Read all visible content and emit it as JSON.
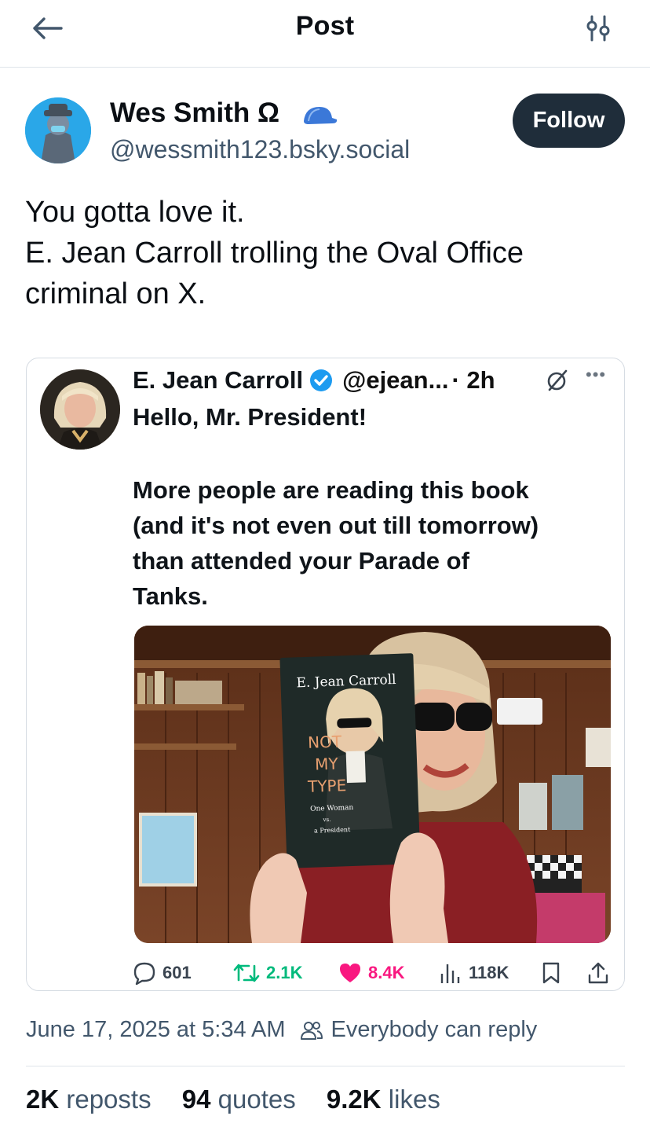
{
  "header": {
    "title": "Post",
    "back_icon": "arrow-left-icon",
    "filter_icon": "sliders-icon"
  },
  "author": {
    "display_name": "Wes Smith Ω",
    "handle": "@wessmith123.bsky.social",
    "badge_icon": "blue-cap-icon",
    "follow_label": "Follow"
  },
  "post": {
    "lines": [
      "You gotta love it.",
      "E. Jean Carroll trolling the Oval Office",
      "criminal on X."
    ]
  },
  "embed": {
    "name": "E. Jean Carroll",
    "handle": "@ejean...",
    "time": "· 2h",
    "body_line1": "Hello, Mr. President!",
    "body_lines": [
      "More people are reading this book",
      "(and it's not even out till tomorrow)",
      "than attended your Parade of",
      "Tanks."
    ],
    "book": {
      "author": "E. Jean Carroll",
      "title_lines": [
        "NOT",
        "MY",
        "TYPE"
      ],
      "subtitle_lines": [
        "One Woman",
        "vs.",
        "a President"
      ]
    },
    "actions": {
      "replies": "601",
      "reposts": "2.1K",
      "likes": "8.4K",
      "views": "118K"
    },
    "colors": {
      "repost": "#00ba7c",
      "like": "#f91880",
      "verified": "#1d9bf0"
    }
  },
  "meta": {
    "timestamp": "June 17, 2025 at 5:34 AM",
    "reply_setting": "Everybody can reply"
  },
  "stats": {
    "reposts_count": "2K",
    "reposts_label": "reposts",
    "quotes_count": "94",
    "quotes_label": "quotes",
    "likes_count": "9.2K",
    "likes_label": "likes"
  }
}
